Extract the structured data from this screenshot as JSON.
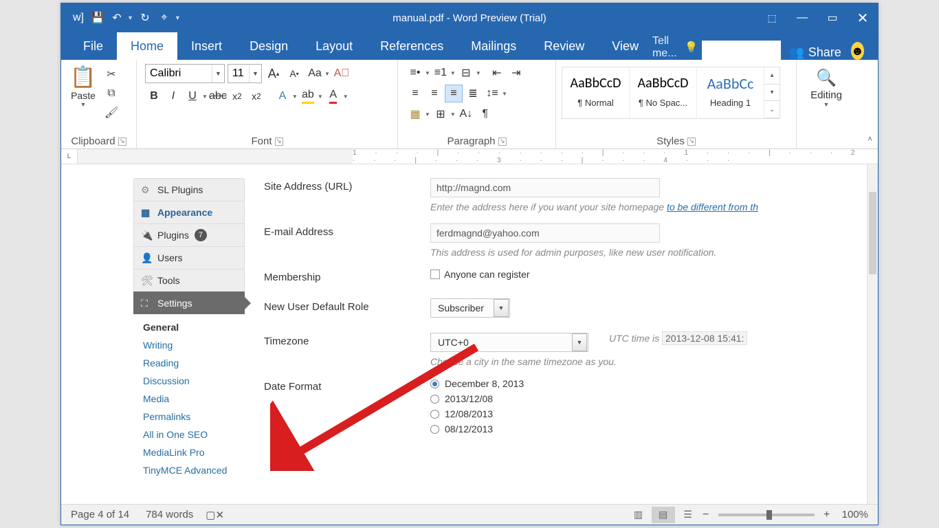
{
  "window": {
    "title": "manual.pdf - Word Preview (Trial)"
  },
  "tabs": {
    "file": "File",
    "home": "Home",
    "insert": "Insert",
    "design": "Design",
    "layout": "Layout",
    "references": "References",
    "mailings": "Mailings",
    "review": "Review",
    "view": "View",
    "tellme": "Tell me...",
    "share": "Share"
  },
  "ribbon": {
    "clipboard": {
      "label": "Clipboard",
      "paste": "Paste"
    },
    "font": {
      "label": "Font",
      "name": "Calibri",
      "size": "11"
    },
    "paragraph": {
      "label": "Paragraph"
    },
    "styles": {
      "label": "Styles",
      "s1_preview": "AaBbCcD",
      "s1_name": "¶ Normal",
      "s2_preview": "AaBbCcD",
      "s2_name": "¶ No Spac...",
      "s3_preview": "AaBbCc",
      "s3_name": "Heading 1"
    },
    "editing": {
      "label": "Editing"
    }
  },
  "wp": {
    "side": {
      "sl_plugins": "SL Plugins",
      "appearance": "Appearance",
      "plugins": "Plugins",
      "plugins_badge": "7",
      "users": "Users",
      "tools": "Tools",
      "settings": "Settings",
      "sub": {
        "general": "General",
        "writing": "Writing",
        "reading": "Reading",
        "discussion": "Discussion",
        "media": "Media",
        "permalinks": "Permalinks",
        "aioseo": "All in One SEO",
        "medialink": "MediaLink Pro",
        "tinymce": "TinyMCE Advanced"
      }
    },
    "form": {
      "site_address_label": "Site Address (URL)",
      "site_address_value": "http://magnd.com",
      "site_address_hint_a": "Enter the address here if you want your site homepage ",
      "site_address_hint_b": "to be different from th",
      "email_label": "E-mail Address",
      "email_value": "ferdmagnd@yahoo.com",
      "email_hint": "This address is used for admin purposes, like new user notification.",
      "membership_label": "Membership",
      "membership_check": "Anyone can register",
      "role_label": "New User Default Role",
      "role_value": "Subscriber",
      "tz_label": "Timezone",
      "tz_value": "UTC+0",
      "tz_hint_a": "UTC time is",
      "tz_hint_b": "2013-12-08 15:41:",
      "tz_hint2": "Choose a city in the same timezone as you.",
      "df_label": "Date Format",
      "df1": "December 8, 2013",
      "df2": "2013/12/08",
      "df3": "12/08/2013",
      "df4": "08/12/2013"
    }
  },
  "status": {
    "page": "Page 4 of 14",
    "words": "784 words",
    "zoom": "100%"
  }
}
